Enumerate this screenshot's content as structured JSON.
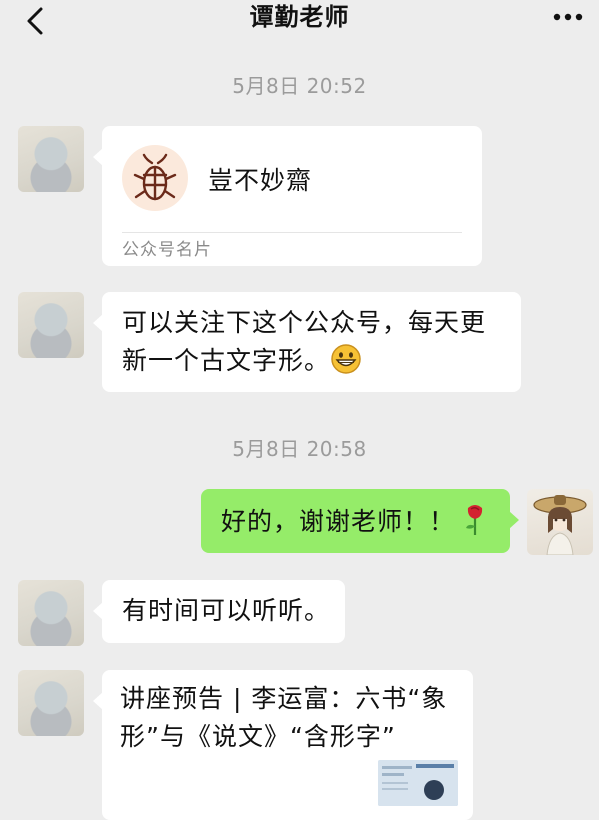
{
  "header": {
    "title": "谭勤老师"
  },
  "messages": [
    {
      "timestamp": "5月8日 20:52"
    },
    {
      "card_name": "豈不妙齋",
      "card_footer": "公众号名片"
    },
    {
      "text": "可以关注下这个公众号，每天更新一个古文字形。"
    },
    {
      "timestamp": "5月8日 20:58"
    },
    {
      "text": "好的，谢谢老师！！"
    },
    {
      "text": "有时间可以听听。"
    },
    {
      "link_title": "讲座预告 | 李运富：六书“象形”与《说文》“含形字”"
    }
  ],
  "colors": {
    "background": "#ededed",
    "sent_bubble": "#95ec69",
    "received_bubble": "#ffffff",
    "timestamp_text": "#9b9b9b"
  },
  "icons": {
    "back": "chevron-left-icon",
    "more": "more-dots-icon",
    "emoji_grin": "grinning-face-icon",
    "emoji_rose": "rose-icon"
  }
}
